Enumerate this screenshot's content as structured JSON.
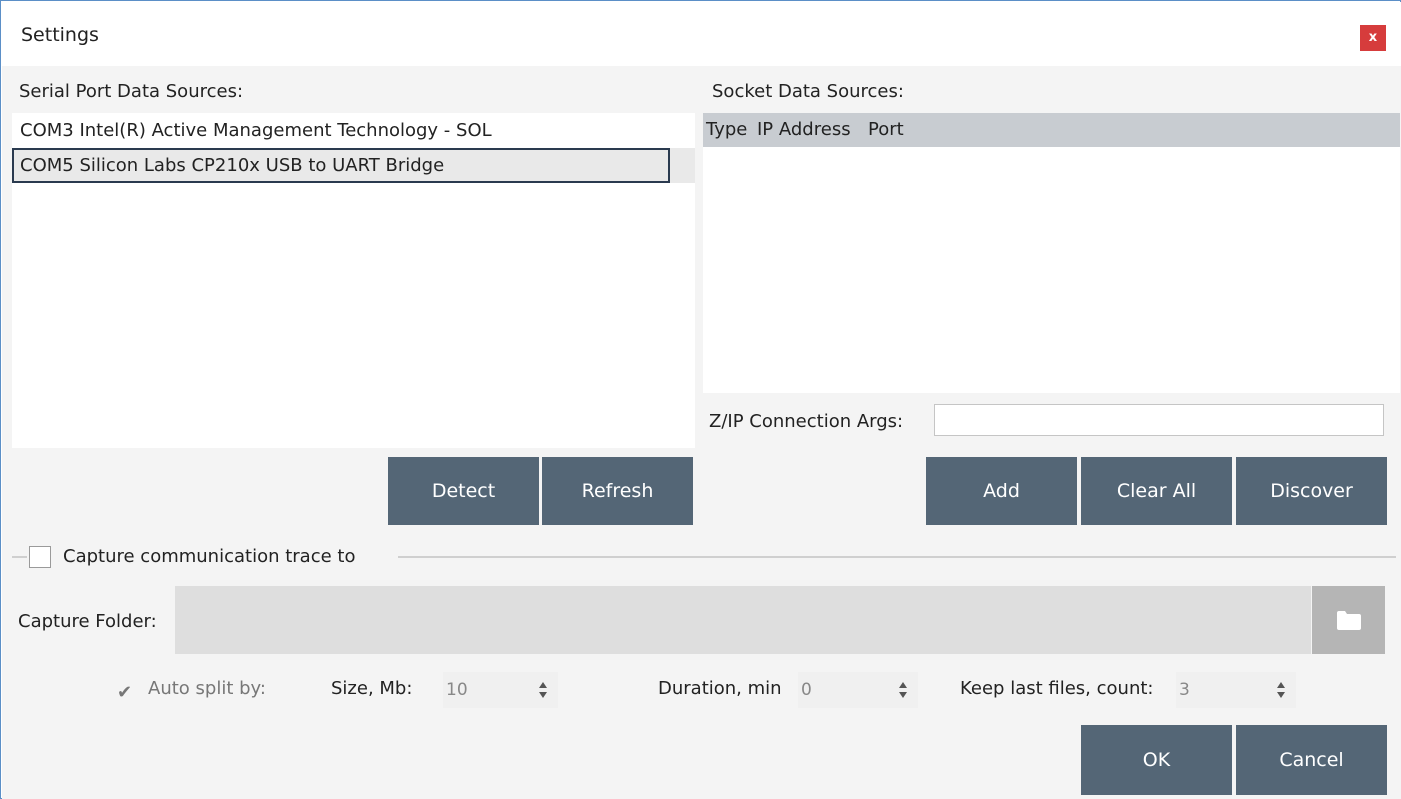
{
  "window": {
    "title": "Settings",
    "close_label": "x"
  },
  "serial": {
    "label": "Serial Port Data Sources:",
    "items": [
      {
        "text": "COM3 Intel(R) Active Management Technology - SOL"
      },
      {
        "text": "COM5 Silicon Labs CP210x USB to UART Bridge",
        "selected": true
      }
    ],
    "detect_label": "Detect",
    "refresh_label": "Refresh"
  },
  "socket": {
    "label": "Socket Data Sources:",
    "columns": [
      "Type",
      "IP Address",
      "Port"
    ],
    "zip_label": "Z/IP Connection Args:",
    "zip_value": "",
    "add_label": "Add",
    "clear_label": "Clear All",
    "discover_label": "Discover"
  },
  "capture": {
    "checkbox_label": "Capture communication trace to",
    "checked": false,
    "folder_label": "Capture Folder:",
    "folder_value": "",
    "auto_split_label": "Auto split by:",
    "auto_split_checked": true,
    "size_label": "Size, Mb:",
    "size_value": "10",
    "duration_label": "Duration, min",
    "duration_value": "0",
    "keep_label": "Keep last files, count:",
    "keep_value": "3"
  },
  "footer": {
    "ok_label": "OK",
    "cancel_label": "Cancel"
  },
  "icons": {
    "close": "close-icon",
    "folder": "folder-icon",
    "check": "checkmark-icon",
    "spin": "spinner-arrows-icon"
  },
  "colors": {
    "button": "#546676",
    "close": "#d63c3c",
    "grid_header": "#c8ccd1"
  }
}
